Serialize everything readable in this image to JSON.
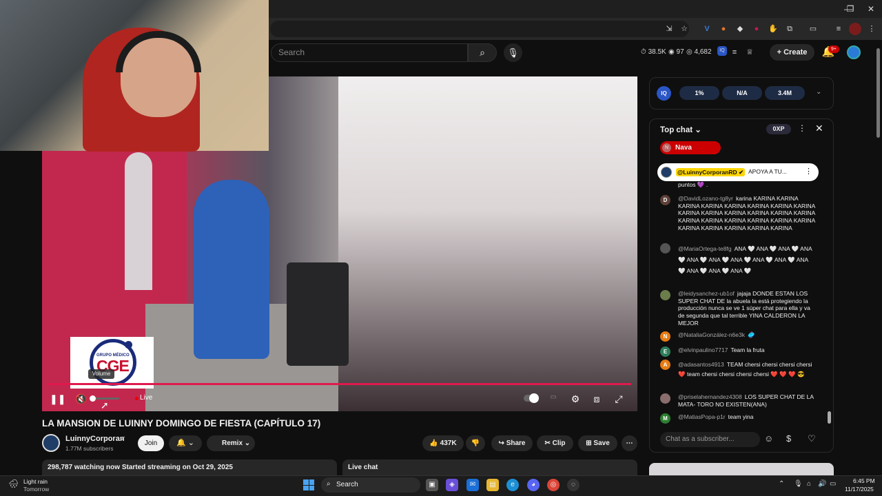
{
  "browser": {
    "window_controls": {
      "minimize": "—",
      "restore": "❐",
      "close": "✕"
    },
    "extensions": [
      "reload-icon",
      "star-icon",
      "v-icon",
      "fox-icon",
      "diamond-icon",
      "record-icon",
      "hand-icon",
      "puzzle-icon",
      "split-icon",
      "menu-icon",
      "avatar-icon",
      "kebab-icon"
    ]
  },
  "header": {
    "search_placeholder": "Search",
    "stats": {
      "likes": "38.5K",
      "viewers": "97",
      "chat": "4,682"
    },
    "create_label": "Create",
    "notif_badge": "9+"
  },
  "player": {
    "logo_small": "GRUPO MÉDICO",
    "logo_big": "CGE",
    "volume_tooltip": "Volume",
    "live_label": "Live",
    "accent": "#e0194d"
  },
  "video": {
    "title": "LA MANSION DE LUINNY DOMINGO DE FIESTA (CAPÍTULO 17)",
    "channel": "LuinnyCorporan",
    "subscribers": "1.77M subscribers",
    "join_label": "Join",
    "remix_label": "Remix",
    "like_count": "437K",
    "share_label": "Share",
    "clip_label": "Clip",
    "save_label": "Save",
    "watching": "298,787 watching now  Started streaming on Oct 29, 2025",
    "live_chat_label": "Live chat"
  },
  "iq": {
    "logo": "IQ",
    "pills": [
      "1%",
      "N/A",
      "3.4M"
    ]
  },
  "chat": {
    "header": "Top chat",
    "xp": "0XP",
    "user_pill": "Nava",
    "user_initial": "N",
    "pinned": {
      "author": "@LuinnyCorporanRD",
      "text": "APOYA A TU..."
    },
    "messages": [
      {
        "initial": "",
        "color": "#0f0f0f",
        "author": "",
        "text": "puntos 💜 ."
      },
      {
        "initial": "D",
        "color": "#5d4037",
        "author": "@DavidLozano-tg8yr",
        "text": "karina KARINA KARINA KARINA KARINA KARINA KARINA KARINA KARINA KARINA KARINA KARINA KARINA KARINA KARINA KARINA KARINA KARINA KARINA KARINA KARINA KARINA KARINA KARINA KARINA KARINA"
      },
      {
        "initial": "",
        "color": "#555555",
        "author": "@MariaOrtega-te8fg",
        "text": "ANA 🤍 ANA 🤍 ANA 🤍 ANA 🤍 ANA 🤍 ANA 🤍 ANA 🤍 ANA 🤍 ANA 🤍 ANA 🤍 ANA 🤍 ANA 🤍 ANA 🤍"
      },
      {
        "initial": "",
        "color": "#6b7d4a",
        "author": "@leidysanchez-ub1of",
        "text": "jajaja DONDE ESTAN LOS SUPER CHAT DE la abuela la está protegiendo la producción nunca se ve 1 súper chat para ella y va de segunda que tal terrible YINA CALDERON LA MEJOR"
      },
      {
        "initial": "N",
        "color": "#e67c13",
        "author": "@NataliaGonzález-n6e3k",
        "text": "🥏"
      },
      {
        "initial": "E",
        "color": "#2e7d5b",
        "author": "@elvinpaulino7717",
        "text": "Team la fruta"
      },
      {
        "initial": "A",
        "color": "#e67c13",
        "author": "@adasantos4913",
        "text": "TEAM chersi chersi chersi chersi ❤️ team chersi chersi chersi chersi ❤️ ❤️ ❤️ 😎"
      },
      {
        "initial": "",
        "color": "#8a6d6d",
        "author": "@priselahernandez4308",
        "text": "LOS SUPER CHAT DE LA MATA- TORO NO EXISTEN(ANA)"
      },
      {
        "initial": "M",
        "color": "#2e7d32",
        "author": "@MatiasPopa-p1r",
        "text": "team yina"
      }
    ],
    "input_placeholder": "Chat as a subscriber..."
  },
  "taskbar": {
    "weather_title": "Light rain",
    "weather_sub": "Tomorrow",
    "search_label": "Search",
    "time": "6:45 PM",
    "date": "11/17/2025"
  }
}
